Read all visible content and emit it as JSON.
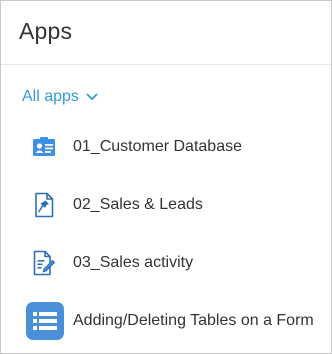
{
  "header": {
    "title": "Apps"
  },
  "filter": {
    "label": "All apps",
    "icon": "chevron-down-icon"
  },
  "apps": [
    {
      "name": "01_Customer Database",
      "icon": "contact-card-icon"
    },
    {
      "name": "02_Sales & Leads",
      "icon": "document-pin-icon"
    },
    {
      "name": "03_Sales activity",
      "icon": "document-edit-icon"
    },
    {
      "name": "Adding/Deleting Tables on a Form",
      "icon": "table-list-icon"
    }
  ],
  "colors": {
    "accent": "#3498db",
    "icon_bg": "#4a90d9",
    "text": "#333333",
    "border": "#c9c9c9"
  }
}
